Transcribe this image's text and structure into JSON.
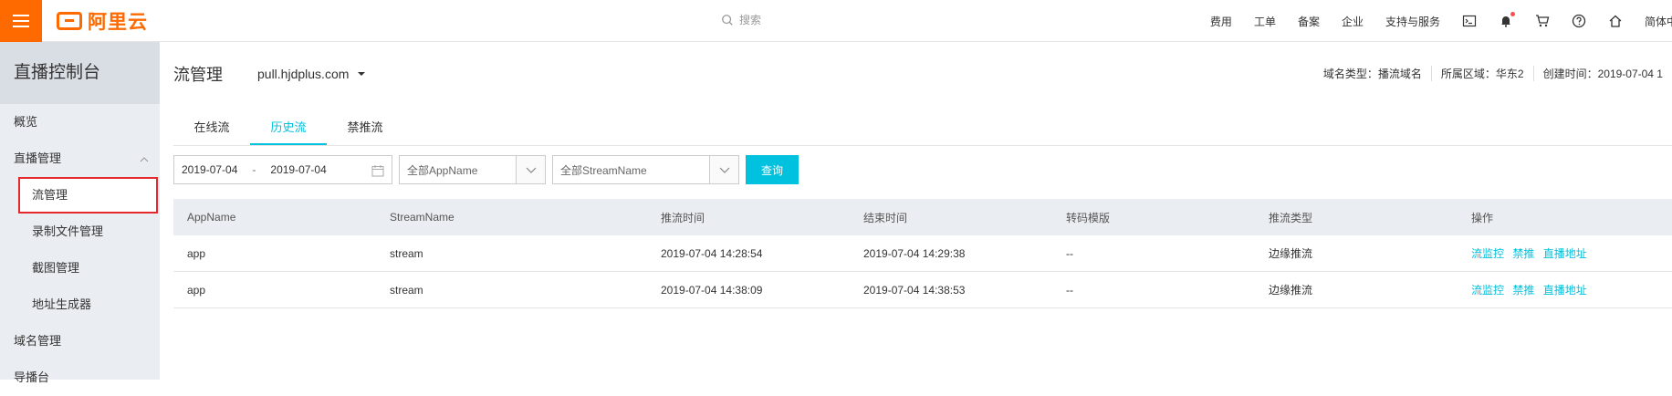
{
  "topbar": {
    "logo_text": "阿里云",
    "search_placeholder": "搜索",
    "nav": [
      "费用",
      "工单",
      "备案",
      "企业",
      "支持与服务"
    ],
    "lang": "简体中文"
  },
  "sidebar": {
    "title": "直播控制台",
    "items": [
      {
        "label": "概览"
      },
      {
        "label": "直播管理"
      },
      {
        "label": "流管理"
      },
      {
        "label": "录制文件管理"
      },
      {
        "label": "截图管理"
      },
      {
        "label": "地址生成器"
      },
      {
        "label": "域名管理"
      },
      {
        "label": "导播台"
      }
    ]
  },
  "header": {
    "title": "流管理",
    "domain": "pull.hjdplus.com",
    "meta": {
      "domain_type": "域名类型：播流域名",
      "region": "所属区域：华东2",
      "created": "创建时间：2019-07-04 1"
    }
  },
  "tabs": [
    "在线流",
    "历史流",
    "禁推流"
  ],
  "filters": {
    "date_start": "2019-07-04",
    "date_sep": "-",
    "date_end": "2019-07-04",
    "app_select": "全部AppName",
    "stream_select": "全部StreamName",
    "query": "查询"
  },
  "table": {
    "headers": [
      "AppName",
      "StreamName",
      "推流时间",
      "结束时间",
      "转码模版",
      "推流类型",
      "操作"
    ],
    "rows": [
      {
        "app": "app",
        "stream": "stream",
        "start": "2019-07-04 14:28:54",
        "end": "2019-07-04 14:29:38",
        "transcode": "--",
        "type": "边缘推流"
      },
      {
        "app": "app",
        "stream": "stream",
        "start": "2019-07-04 14:38:09",
        "end": "2019-07-04 14:38:53",
        "transcode": "--",
        "type": "边缘推流"
      }
    ],
    "ops": [
      "流监控",
      "禁推",
      "直播地址"
    ]
  }
}
